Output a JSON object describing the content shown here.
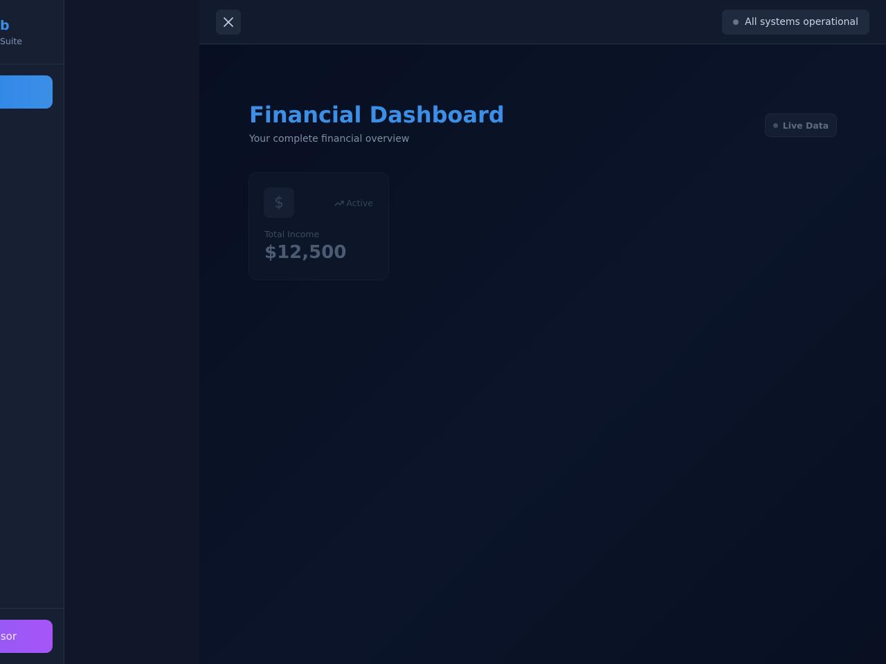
{
  "sidebar": {
    "brand_title": "b",
    "brand_subtitle": "Suite",
    "active_nav_label": "",
    "advisor_label": "sor"
  },
  "topbar": {
    "close_icon": "close-icon",
    "status_text": "All systems operational"
  },
  "main": {
    "title": "Financial Dashboard",
    "subtitle": "Your complete financial overview",
    "live_label": "Live Data",
    "stat_card": {
      "icon": "dollar-icon",
      "trend_label": "Active",
      "label": "Total Income",
      "value": "$12,500"
    }
  },
  "colors": {
    "accent": "#3b8fe6",
    "advisor": "#a855f7",
    "background": "#0a1226"
  }
}
